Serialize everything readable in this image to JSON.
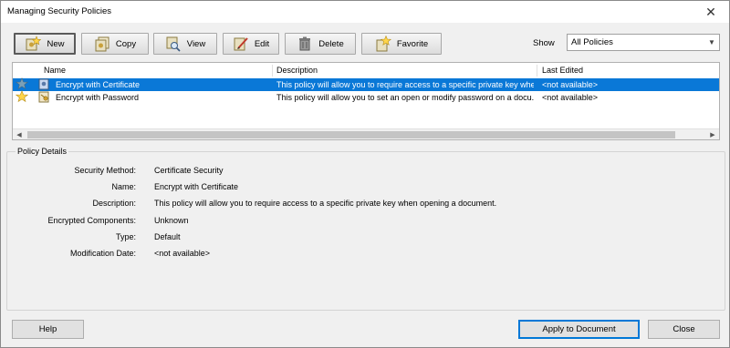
{
  "window": {
    "title": "Managing Security Policies"
  },
  "toolbar": {
    "new_label": "New",
    "copy_label": "Copy",
    "view_label": "View",
    "edit_label": "Edit",
    "delete_label": "Delete",
    "favorite_label": "Favorite"
  },
  "filter": {
    "label": "Show",
    "value": "All Policies"
  },
  "table": {
    "columns": [
      "Name",
      "Description",
      "Last Edited"
    ],
    "rows": [
      {
        "name": "Encrypt with Certificate",
        "description": "This policy will allow you to require access to a specific private key whe...",
        "last_edited": "<not available>",
        "favorite": false,
        "selected": true
      },
      {
        "name": "Encrypt with Password",
        "description": "This policy will allow you to set an open or modify password on a docu...",
        "last_edited": "<not available>",
        "favorite": true,
        "selected": false
      }
    ]
  },
  "details": {
    "title": "Policy Details",
    "security_method_label": "Security Method:",
    "security_method": "Certificate Security",
    "name_label": "Name:",
    "name": "Encrypt with Certificate",
    "description_label": "Description:",
    "description": "This policy will allow you to require access to a specific private key when opening a document.",
    "components_label": "Encrypted Components:",
    "components": "Unknown",
    "type_label": "Type:",
    "type": "Default",
    "modified_label": "Modification Date:",
    "modified": "<not available>"
  },
  "footer": {
    "help_label": "Help",
    "apply_label": "Apply to Document",
    "close_label": "Close"
  },
  "colors": {
    "selection": "#0a78d7",
    "accent": "#0078d7"
  }
}
